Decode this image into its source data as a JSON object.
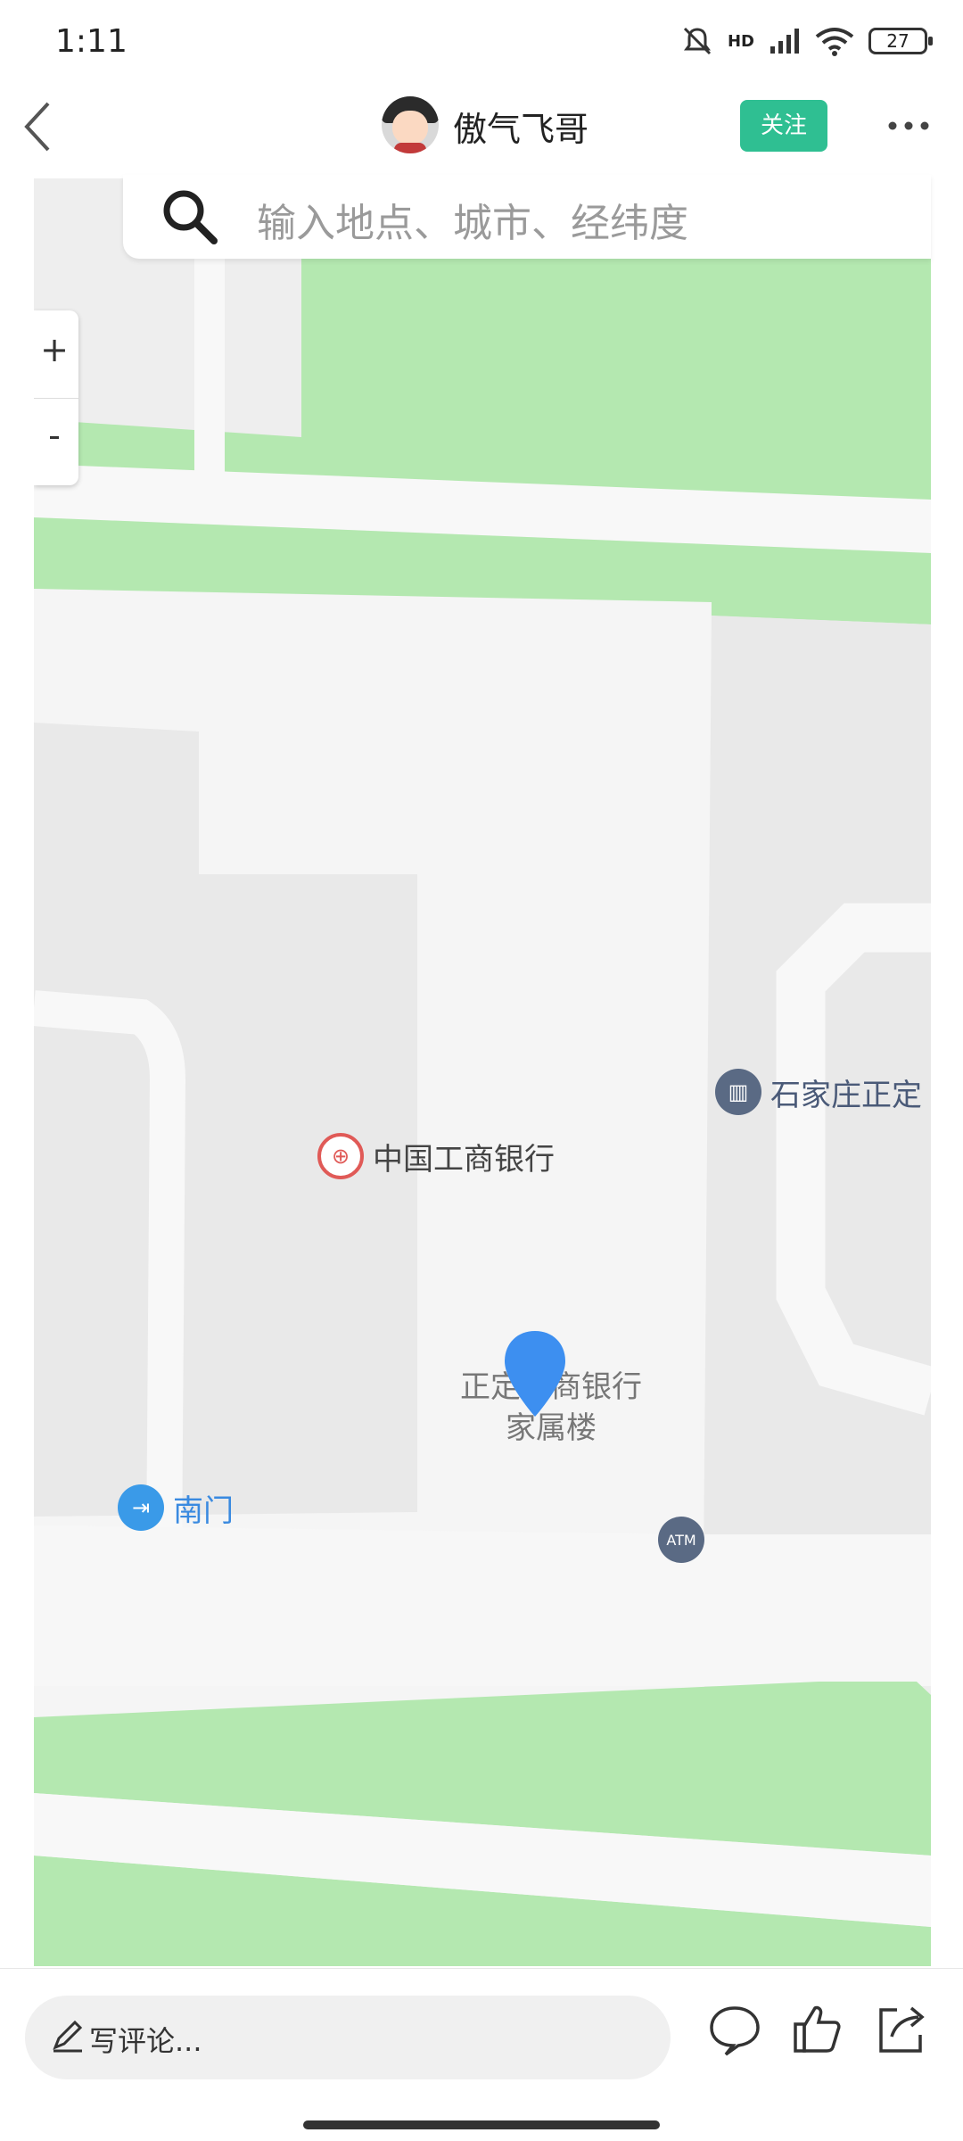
{
  "status": {
    "time": "1:11",
    "network": "HD",
    "battery": "27"
  },
  "header": {
    "back_icon": "chevron-left-icon",
    "username": "傲气飞哥",
    "follow_label": "关注",
    "more_icon": "more-horizontal-icon"
  },
  "map": {
    "search_placeholder": "输入地点、城市、经纬度",
    "zoom_in": "+",
    "zoom_out": "-",
    "pois": {
      "icbc": "中国工商银行",
      "shijiazhuang": "石家庄正定",
      "south_gate": "南门",
      "atm": "ATM",
      "building_line1": "正定工商银行",
      "building_line2": "家属楼"
    },
    "colors": {
      "green": "#b4e8b0",
      "road": "#f7f7f7",
      "block": "#e9e9e9",
      "marker": "#3d8ff0"
    }
  },
  "bottom": {
    "comment_placeholder": "写评论..."
  }
}
